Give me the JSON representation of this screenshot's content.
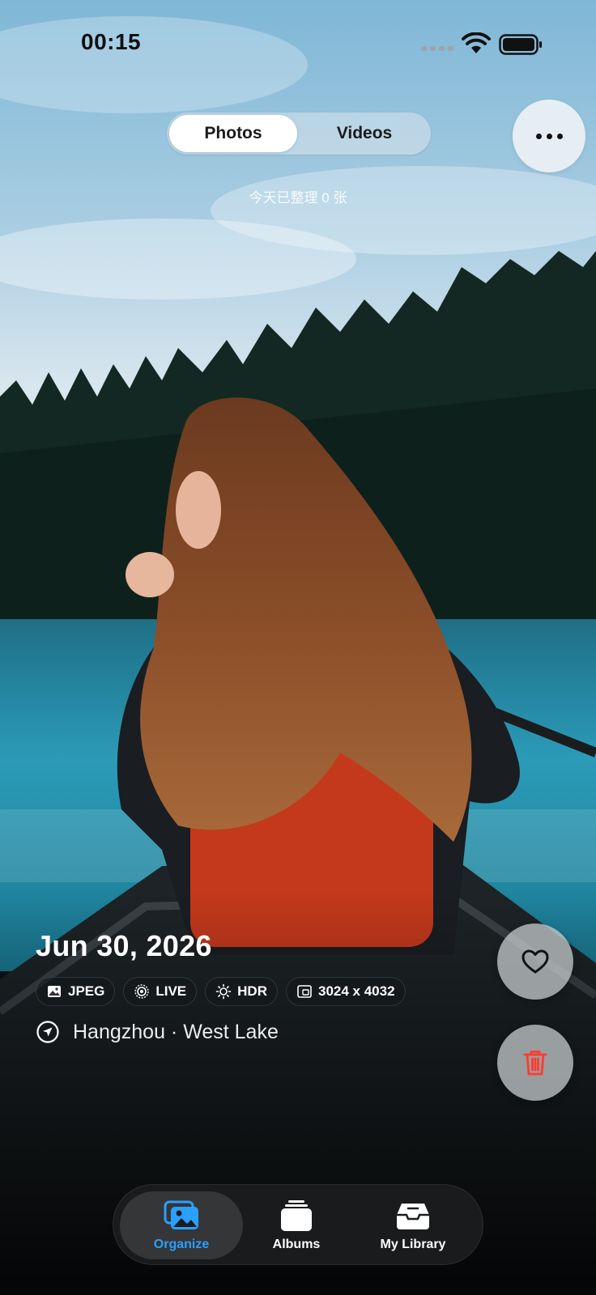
{
  "status_bar": {
    "time": "00:15"
  },
  "header": {
    "segments": [
      {
        "label": "Photos",
        "selected": true
      },
      {
        "label": "Videos",
        "selected": false
      }
    ],
    "more_icon": "ellipsis-icon",
    "today_count": "今天已整理 0 张"
  },
  "photo_info": {
    "date": "Jun 30, 2026",
    "tags": [
      {
        "icon": "image-icon",
        "label": "JPEG"
      },
      {
        "icon": "live-icon",
        "label": "LIVE"
      },
      {
        "icon": "sun-icon",
        "label": "HDR"
      },
      {
        "icon": "dimensions-icon",
        "label": "3024 x 4032"
      }
    ],
    "location_icon": "location-arrow-icon",
    "location": "Hangzhou · West Lake"
  },
  "actions": {
    "like_icon": "heart-icon",
    "delete_icon": "trash-icon",
    "delete_color": "#ff3b30"
  },
  "tab_bar": {
    "accent_color": "#2aa0ff",
    "tabs": [
      {
        "label": "Organize",
        "icon": "photos-stack-icon",
        "selected": true
      },
      {
        "label": "Albums",
        "icon": "albums-stack-icon",
        "selected": false
      },
      {
        "label": "My Library",
        "icon": "tray-icon",
        "selected": false
      }
    ]
  }
}
